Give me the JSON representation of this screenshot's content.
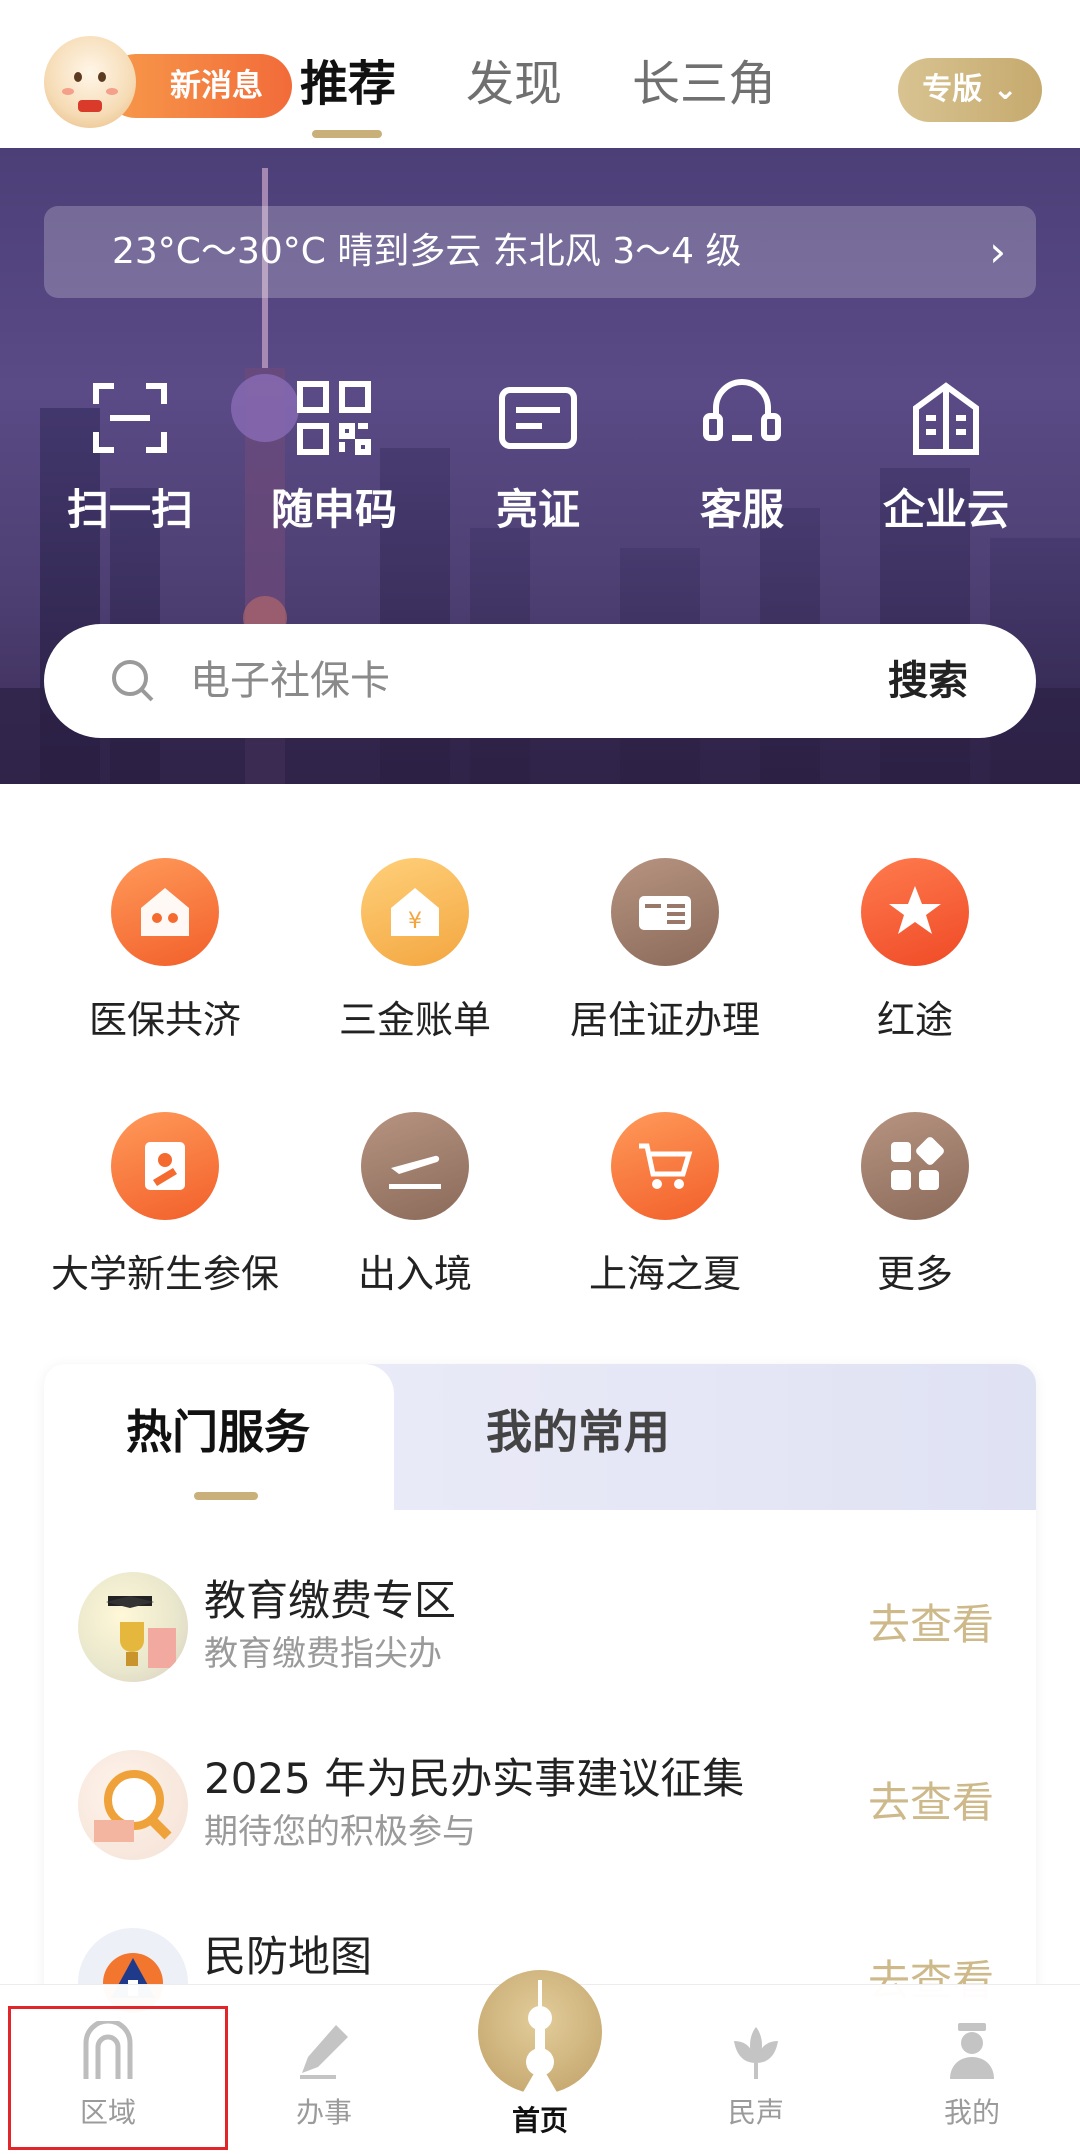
{
  "topbar": {
    "message_badge": "新消息",
    "tabs": [
      {
        "label": "推荐",
        "active": true
      },
      {
        "label": "发现",
        "active": false
      },
      {
        "label": "长三角",
        "active": false
      }
    ],
    "edition_button": "专版"
  },
  "hero": {
    "weather": "23°C～30°C 晴到多云 东北风 3～4 级",
    "quick_actions": [
      {
        "label": "扫一扫",
        "icon": "scan-icon"
      },
      {
        "label": "随申码",
        "icon": "qrcode-icon"
      },
      {
        "label": "亮证",
        "icon": "card-icon"
      },
      {
        "label": "客服",
        "icon": "headset-icon"
      },
      {
        "label": "企业云",
        "icon": "building-icon"
      }
    ],
    "search": {
      "placeholder": "电子社保卡",
      "button": "搜索"
    }
  },
  "services": [
    {
      "label": "医保共济",
      "icon": "family-house-icon",
      "color": "#f5712f"
    },
    {
      "label": "三金账单",
      "icon": "yuan-house-icon",
      "color": "#f6ad47"
    },
    {
      "label": "居住证办理",
      "icon": "residence-card-icon",
      "color": "#9a7869"
    },
    {
      "label": "红途",
      "icon": "star-flag-icon",
      "color": "#f0552c"
    },
    {
      "label": "大学新生参保",
      "icon": "student-doc-icon",
      "color": "#f5712f"
    },
    {
      "label": "出入境",
      "icon": "airplane-icon",
      "color": "#9a7869"
    },
    {
      "label": "上海之夏",
      "icon": "cart-icon",
      "color": "#f5712f"
    },
    {
      "label": "更多",
      "icon": "more-grid-icon",
      "color": "#9a7869"
    }
  ],
  "card": {
    "tabs": [
      {
        "label": "热门服务",
        "active": true
      },
      {
        "label": "我的常用",
        "active": false
      }
    ],
    "items": [
      {
        "title": "教育缴费专区",
        "subtitle": "教育缴费指尖办",
        "action": "去查看"
      },
      {
        "title": "2025 年为民办实事建议征集",
        "subtitle": "期待您的积极参与",
        "action": "去查看"
      },
      {
        "title": "民防地图",
        "subtitle": "",
        "action": "去查看"
      }
    ]
  },
  "tabbar": {
    "items": [
      {
        "label": "区域",
        "icon": "gate-icon"
      },
      {
        "label": "办事",
        "icon": "pen-icon"
      },
      {
        "label": "首页",
        "icon": "tower-icon"
      },
      {
        "label": "民声",
        "icon": "magnolia-icon"
      },
      {
        "label": "我的",
        "icon": "person-icon"
      }
    ]
  },
  "colors": {
    "accent_gold": "#c9b07a",
    "hero_purple": "#4f4179",
    "orange": "#f5712f",
    "highlight_red": "#e0262b"
  }
}
